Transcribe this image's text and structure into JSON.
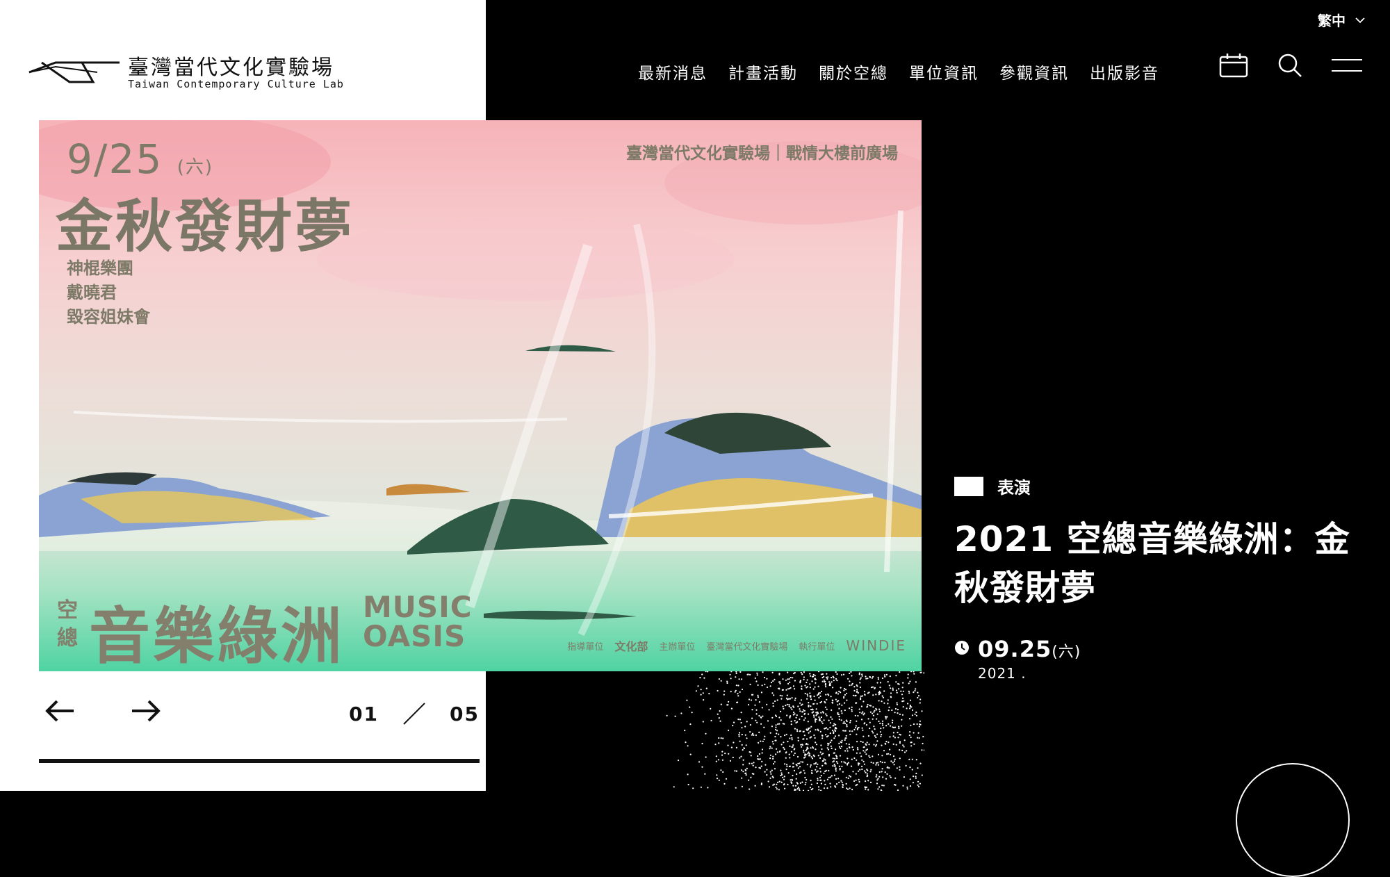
{
  "brand": {
    "name_zh": "臺灣當代文化實驗場",
    "name_en": "Taiwan Contemporary Culture Lab"
  },
  "lang": {
    "current": "繁中"
  },
  "nav": [
    "最新消息",
    "計畫活動",
    "關於空總",
    "單位資訊",
    "參觀資訊",
    "出版影音"
  ],
  "poster": {
    "date": "9/25",
    "weekday": "(六)",
    "venue": "臺灣當代文化實驗場｜戰情大樓前廣場",
    "title": "金秋發財夢",
    "artists": [
      "神棍樂團",
      "戴曉君",
      "毀容姐妹會"
    ],
    "brand_mark": "空總",
    "oasis_zh": "音樂綠洲",
    "oasis_en": [
      "MUSIC",
      "OASIS"
    ],
    "sponsors": [
      "指導單位",
      "文化部",
      "主辦單位",
      "臺灣當代文化實驗場",
      "執行單位",
      "WINDIE"
    ]
  },
  "slider": {
    "current": "01",
    "total": "05",
    "progress": 1.0
  },
  "event": {
    "category": "表演",
    "title": "2021 空總音樂綠洲：金秋發財夢",
    "date": "09.25",
    "weekday": "(六)",
    "year": "2021 ."
  },
  "colors": {
    "accent": "#ffffff",
    "background": "#000000",
    "panel": "#ffffff",
    "poster_text": "#7e7a68"
  },
  "icons": [
    "logo-icon",
    "chevron-down-icon",
    "calendar-icon",
    "search-icon",
    "menu-icon",
    "arrow-left-icon",
    "arrow-right-icon",
    "clock-icon"
  ]
}
